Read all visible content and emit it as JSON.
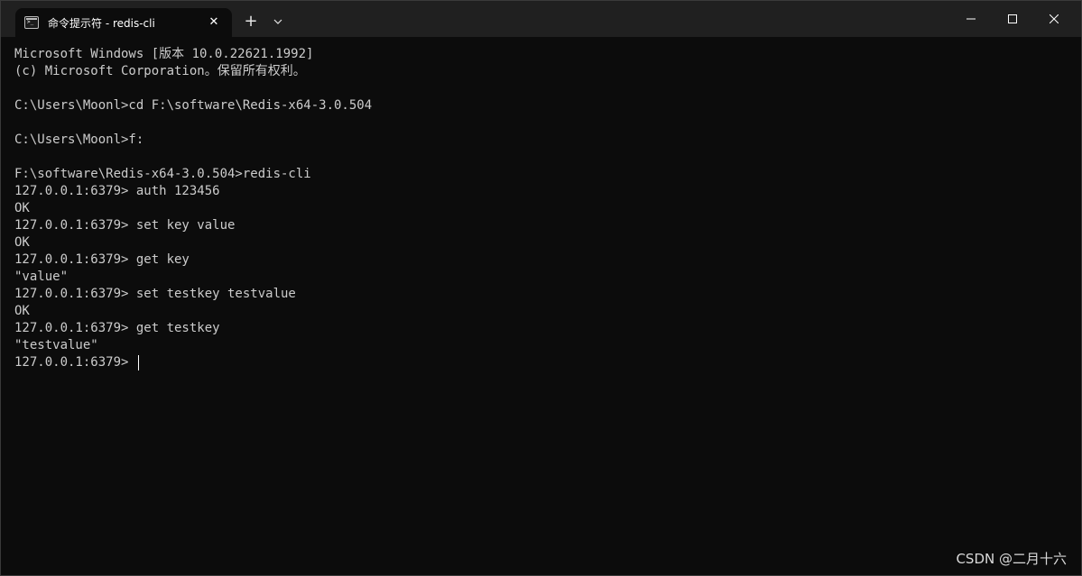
{
  "window": {
    "tab_title": "命令提示符 - redis-cli",
    "tab_icon": "terminal-icon",
    "close_tab_glyph": "✕",
    "new_tab_glyph": "+",
    "dropdown_icon": "chevron-down-icon",
    "minimize_icon": "minimize-icon",
    "maximize_icon": "maximize-icon",
    "close_icon": "close-icon"
  },
  "terminal": {
    "lines": [
      "Microsoft Windows [版本 10.0.22621.1992]",
      "(c) Microsoft Corporation。保留所有权利。",
      "",
      "C:\\Users\\Moonl>cd F:\\software\\Redis-x64-3.0.504",
      "",
      "C:\\Users\\Moonl>f:",
      "",
      "F:\\software\\Redis-x64-3.0.504>redis-cli",
      "127.0.0.1:6379> auth 123456",
      "OK",
      "127.0.0.1:6379> set key value",
      "OK",
      "127.0.0.1:6379> get key",
      "\"value\"",
      "127.0.0.1:6379> set testkey testvalue",
      "OK",
      "127.0.0.1:6379> get testkey",
      "\"testvalue\"",
      "127.0.0.1:6379> "
    ]
  },
  "watermark": "CSDN @二月十六",
  "colors": {
    "background": "#0c0c0c",
    "titlebar": "#202020",
    "text": "#cccccc"
  }
}
